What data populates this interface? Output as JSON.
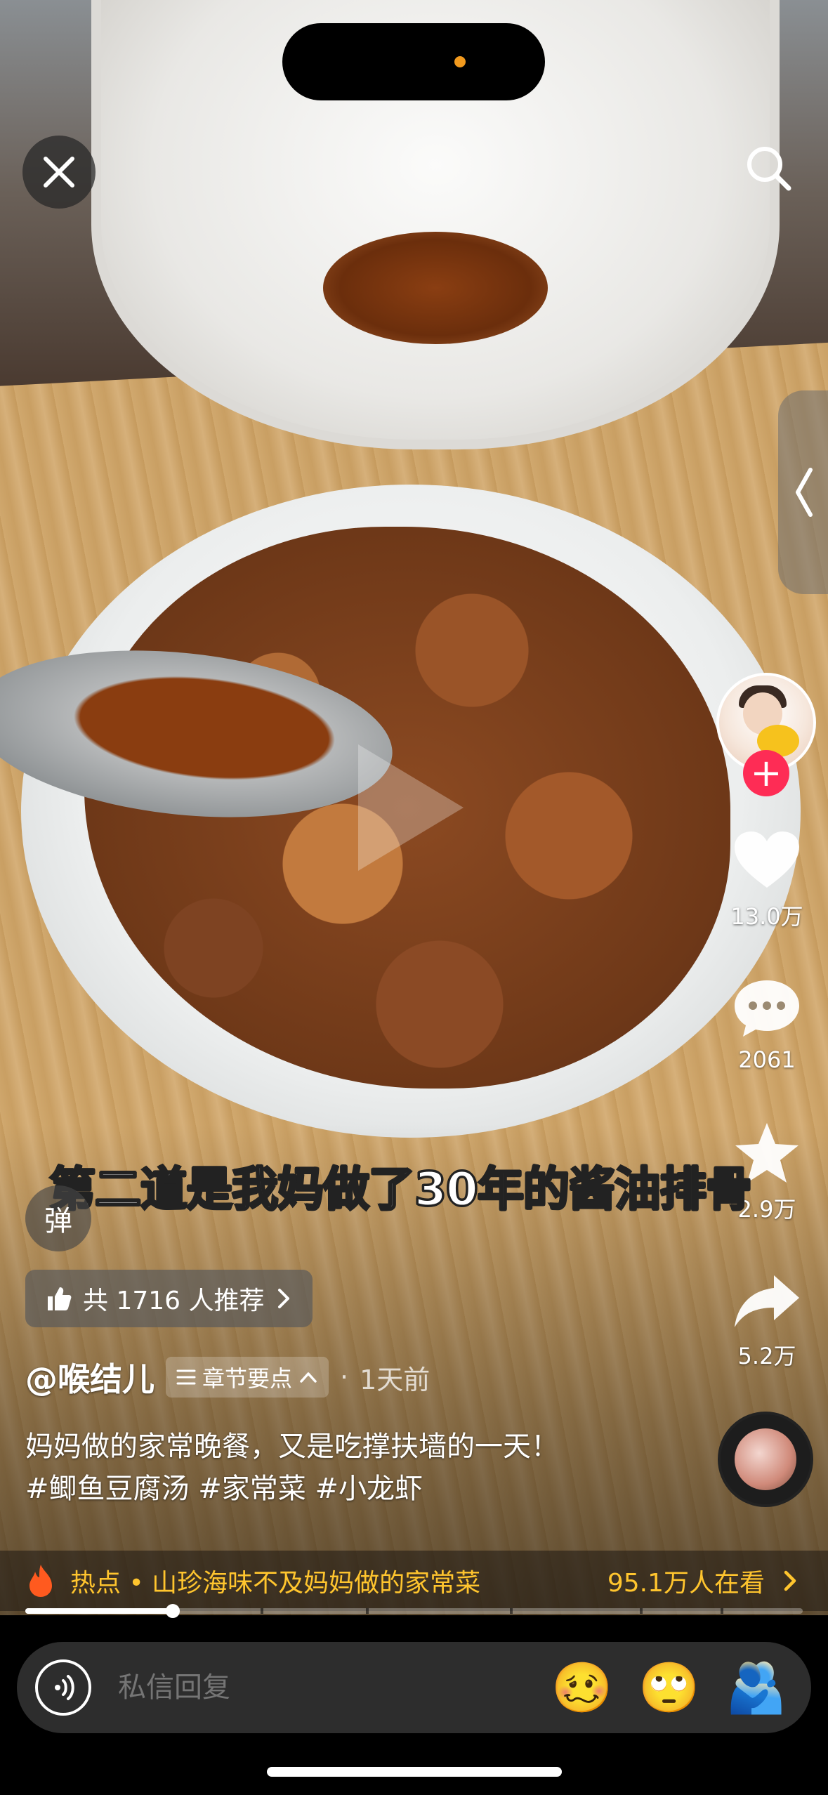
{
  "video": {
    "caption": "第二道是我妈做了30年的酱油排骨"
  },
  "top_bar": {
    "close_icon": "close-icon",
    "search_icon": "search-icon"
  },
  "side_panel": {
    "handle_icon": "chevron-left-icon"
  },
  "creator": {
    "follow_symbol": "+",
    "handle": "@喉结儿"
  },
  "actions": {
    "like_count": "13.0万",
    "comment_count": "2061",
    "favorite_count": "2.9万",
    "share_count": "5.2万"
  },
  "danmu": {
    "label": "弹"
  },
  "recommend": {
    "text": "共 1716 人推荐"
  },
  "meta": {
    "chapter_label": "章节要点",
    "separator": "·",
    "time_ago": "1天前"
  },
  "description": {
    "line1": "妈妈做的家常晚餐，又是吃撑扶墙的一天！",
    "line2": "#鲫鱼豆腐汤 #家常菜 #小龙虾"
  },
  "hot": {
    "topic": "热点 • 山珍海味不及妈妈做的家常菜",
    "viewers": "95.1万人在看"
  },
  "progress": {
    "played_fraction": 0.19
  },
  "reply": {
    "placeholder": "私信回复",
    "emojis": [
      "🥴",
      "🙄",
      "🫂"
    ]
  },
  "colors": {
    "accent_red": "#fe2c55",
    "hot_yellow": "#ffc52e",
    "fire_orange": "#ff5a1f"
  }
}
